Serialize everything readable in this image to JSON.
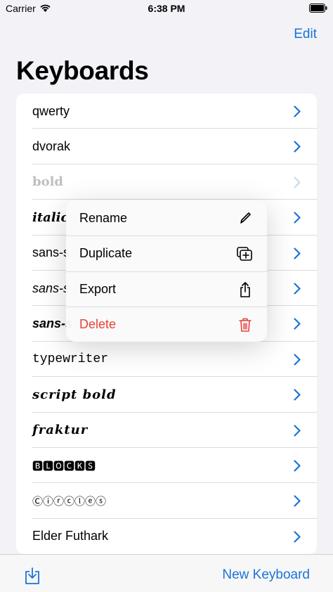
{
  "status_bar": {
    "carrier": "Carrier",
    "time": "6:38 PM"
  },
  "nav": {
    "edit_label": "Edit",
    "title": "Keyboards"
  },
  "keyboards": [
    "qwerty",
    "dvorak",
    "bold",
    "italic",
    "sans-s",
    "sans-s",
    "sans-s",
    "typewriter",
    "script bold",
    "fraktur",
    "🅱🅻🅾🅲🅺🆂",
    "Ⓒⓘⓡⓒⓛⓔⓢ",
    "Elder Futhark"
  ],
  "context_menu": {
    "rename": "Rename",
    "duplicate": "Duplicate",
    "export": "Export",
    "delete": "Delete"
  },
  "toolbar": {
    "new_keyboard_label": "New Keyboard"
  },
  "colors": {
    "accent": "#1a73d9",
    "destructive": "#e5433a",
    "background": "#f2f2f7"
  }
}
